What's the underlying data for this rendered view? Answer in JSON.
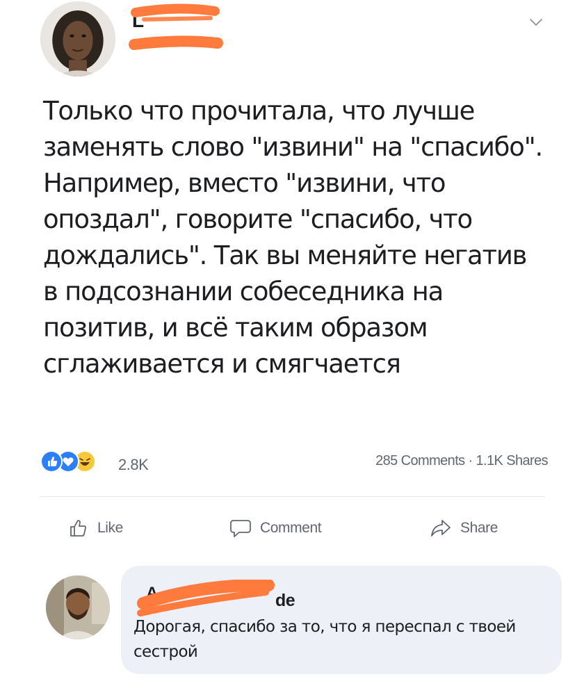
{
  "post": {
    "author": {
      "name_fragment": "L",
      "avatar_icon": "avatar-photo-woman"
    },
    "menu_icon": "chevron-down-icon",
    "text": "Только что прочитала, что лучше заменять слово \"извини\" на \"спасибо\". Например, вместо \"извини, что опоздал\", говорите \"спасибо, что дождались\". Так вы меняйте негатив в подсознании собеседника на позитив, и всё таким образом сглаживается и смягчается"
  },
  "stats": {
    "reactions": [
      "like",
      "love",
      "haha"
    ],
    "reaction_count": "2.8K",
    "comments_shares": "285 Comments · 1.1K Shares"
  },
  "actions": {
    "like_label": "Like",
    "comment_label": "Comment",
    "share_label": "Share"
  },
  "comment": {
    "author_fragment_start": "A",
    "author_fragment_end": "de",
    "avatar_icon": "avatar-photo-man",
    "text": "Дорогая, спасибо за то, что я переспал с твоей сестрой"
  },
  "colors": {
    "redaction_orange": "#ff7a3d",
    "reaction_like_blue": "#2d7ff9",
    "reaction_haha_yellow": "#f7c83a",
    "muted_text": "#606770",
    "comment_bubble": "#edf0f6"
  }
}
